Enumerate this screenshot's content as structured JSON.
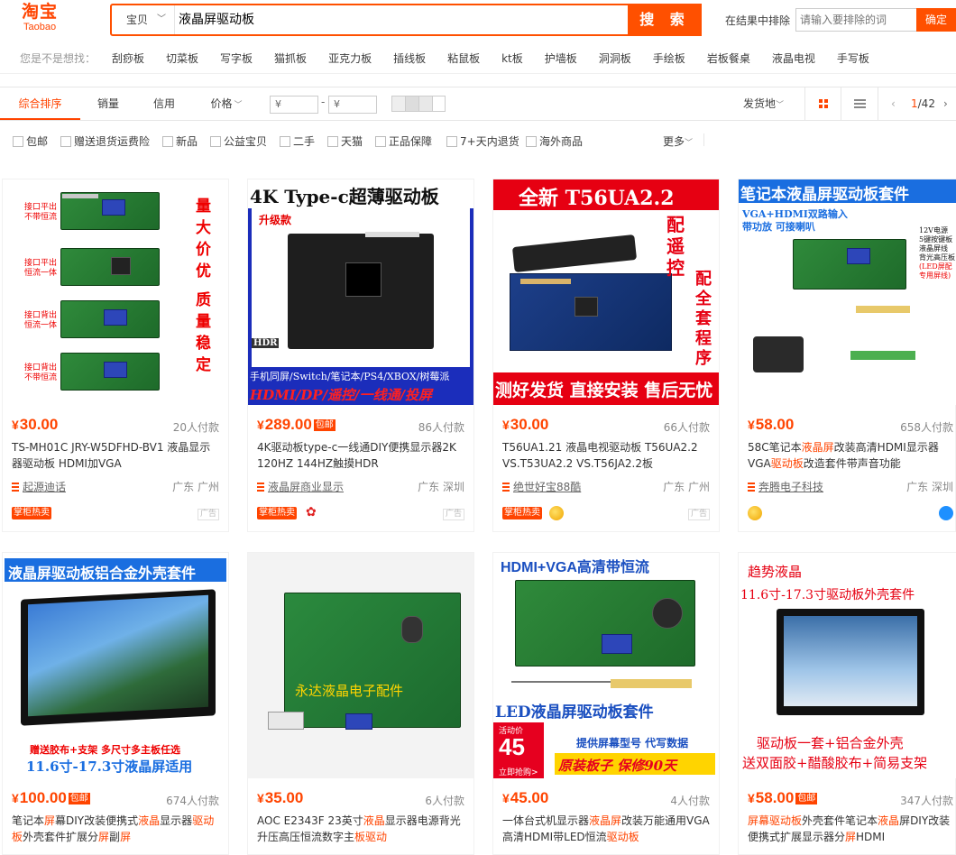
{
  "logo": {
    "cn": "淘宝",
    "en": "Taobao"
  },
  "search": {
    "scope": "宝贝",
    "query": "液晶屏驱动板",
    "button": "搜 索"
  },
  "exclude": {
    "label": "在结果中排除",
    "placeholder": "请输入要排除的词",
    "button": "确定"
  },
  "suggest": {
    "label": "您是不是想找：",
    "items": [
      "刮痧板",
      "切菜板",
      "写字板",
      "猫抓板",
      "亚克力板",
      "插线板",
      "粘鼠板",
      "kt板",
      "护墙板",
      "洞洞板",
      "手绘板",
      "岩板餐桌",
      "液晶电视",
      "手写板"
    ]
  },
  "sort": {
    "tabs": [
      "综合排序",
      "销量",
      "信用",
      "价格"
    ],
    "price_from": "¥",
    "price_to": "¥",
    "price_dash": "-",
    "ship_from": "发货地",
    "page_current": "1",
    "page_total": "/42"
  },
  "filters": {
    "items": [
      "包邮",
      "赠送退货运费险",
      "新品",
      "公益宝贝",
      "二手",
      "天猫",
      "正品保障",
      "7+天内退货",
      "海外商品"
    ],
    "more": "更多"
  },
  "products": [
    {
      "price": "30.00",
      "baoyou": false,
      "paid": "20人付款",
      "title_parts": [
        [
          "TS-MH01C JRY-W5DFHD-BV1 液晶显示器驱动板 HDMI加VGA",
          false
        ]
      ],
      "shop": "起源迪话",
      "location": "广东 广州",
      "hot_tag": "掌柜热卖",
      "ad": "广告",
      "img_texts": [
        "量",
        "大",
        "价",
        "优",
        "质",
        "量",
        "稳",
        "定",
        "接口平出",
        "不带恒流",
        "接口平出",
        "恒流一体",
        "接口背出",
        "恒流一体",
        "接口背出",
        "不带恒流"
      ]
    },
    {
      "price": "289.00",
      "baoyou": true,
      "paid": "86人付款",
      "title_parts": [
        [
          "4K驱动板type-c一线通DIY便携显示器2K 120HZ 144HZ触摸HDR",
          false
        ]
      ],
      "shop": "液晶屏商业显示",
      "location": "广东 深圳",
      "hot_tag": "掌柜热卖",
      "ad": "广告",
      "img_texts": [
        "4K Type-c超薄驱动板",
        "升级款",
        "HDR",
        "手机同屏/Switch/笔记本/PS4/XBOX/树莓派",
        "HDMI/DP/遥控/一线通/投屏"
      ]
    },
    {
      "price": "30.00",
      "baoyou": false,
      "paid": "66人付款",
      "title_parts": [
        [
          "T56UA1.21 液晶电视驱动板 T56UA2.2 VS.T53UA2.2 VS.T56JA2.2板",
          false
        ]
      ],
      "shop": "绝世好宝88酷",
      "location": "广东 广州",
      "hot_tag": "掌柜热卖",
      "ad": "广告",
      "img_texts": [
        "全新 T56UA2.2",
        "配遥控",
        "配全套程序",
        "测好发货 直接安装 售后无忧"
      ]
    },
    {
      "price": "58.00",
      "baoyou": false,
      "paid": "658人付款",
      "title_parts": [
        [
          "58C笔记本",
          false
        ],
        [
          "液晶屏",
          true
        ],
        [
          "改装高清HDMI显示器VGA",
          false
        ],
        [
          "驱动板",
          true
        ],
        [
          "改造套件带声音功能",
          false
        ]
      ],
      "shop": "奔腾电子科技",
      "location": "广东 深圳",
      "hot_tag": "",
      "ad": "",
      "img_texts": [
        "笔记本液晶屏驱动板套件",
        "VGA+HDMI双路输入",
        "带功放 可接喇叭",
        "12V电源",
        "5键按键板",
        "液晶屏线",
        "背光高压板",
        "(LED屏配",
        "专用屏线)"
      ]
    },
    {
      "price": "100.00",
      "baoyou": true,
      "paid": "674人付款",
      "title_parts": [
        [
          "笔记本",
          false
        ],
        [
          "屏",
          true
        ],
        [
          "幕DIY改装便携式",
          false
        ],
        [
          "液晶",
          true
        ],
        [
          "显示器",
          false
        ],
        [
          "驱动板",
          true
        ],
        [
          "外壳套件扩展分",
          false
        ],
        [
          "屏",
          true
        ],
        [
          "副",
          false
        ],
        [
          "屏",
          true
        ]
      ],
      "shop": "",
      "location": "",
      "hot_tag": "",
      "ad": "",
      "img_texts": [
        "液晶屏驱动板铝合金外壳套件",
        "赠送胶布+支架 多尺寸多主板任选",
        "11.6寸-17.3寸液晶屏适用"
      ]
    },
    {
      "price": "35.00",
      "baoyou": false,
      "paid": "6人付款",
      "title_parts": [
        [
          "AOC E2343F 23英寸",
          false
        ],
        [
          "液晶",
          true
        ],
        [
          "显示器电源背光升压高压恒流数字主",
          false
        ],
        [
          "板",
          true
        ],
        [
          "驱动",
          true
        ]
      ],
      "shop": "",
      "location": "",
      "hot_tag": "",
      "ad": "",
      "img_texts": [
        "永达液晶电子配件"
      ]
    },
    {
      "price": "45.00",
      "baoyou": false,
      "paid": "4人付款",
      "title_parts": [
        [
          "一体台式机显示器",
          false
        ],
        [
          "液晶屏",
          true
        ],
        [
          "改装万能通用VGA高清HDMI带LED恒流",
          false
        ],
        [
          "驱动板",
          true
        ]
      ],
      "shop": "",
      "location": "",
      "hot_tag": "",
      "ad": "",
      "img_texts": [
        "HDMI+VGA高清带恒流",
        "LED液晶屏驱动板套件",
        "活动价",
        "45",
        "立即抢购>",
        "提供屏幕型号 代写数据",
        "原装板子 保修90天"
      ]
    },
    {
      "price": "58.00",
      "baoyou": true,
      "paid": "347人付款",
      "title_parts": [
        [
          "屏幕",
          true
        ],
        [
          "驱动板",
          true
        ],
        [
          "外壳套件笔记本",
          false
        ],
        [
          "液晶",
          true
        ],
        [
          "屏DIY改装便携式扩展显示器分",
          false
        ],
        [
          "屏",
          true
        ],
        [
          "HDMI",
          false
        ]
      ],
      "shop": "",
      "location": "",
      "hot_tag": "",
      "ad": "",
      "img_texts": [
        "趋势液晶",
        "11.6寸-17.3寸驱动板外壳套件",
        "驱动板一套+铝合金外壳",
        "送双面胶+醋酸胶布+简易支架"
      ]
    }
  ],
  "colors": {
    "accent": "#ff5000",
    "price": "#ff4400",
    "blue_banner": "#1a6ee0",
    "red_banner": "#e60012"
  }
}
